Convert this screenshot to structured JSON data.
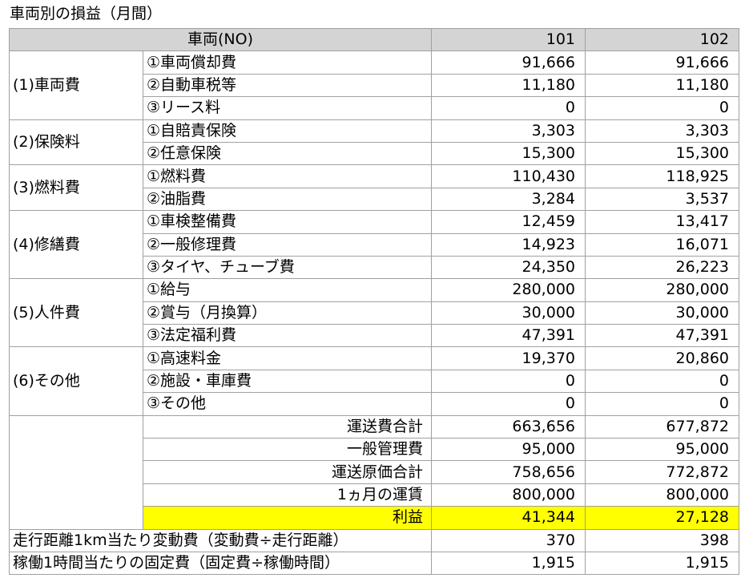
{
  "title": "車両別の損益（月間）",
  "header": {
    "label": "車両(NO)",
    "vehicles": [
      "101",
      "102"
    ]
  },
  "groups": [
    {
      "name": "(1)車両費",
      "items": [
        {
          "label": "①車両償却費",
          "values": [
            "91,666",
            "91,666"
          ]
        },
        {
          "label": "②自動車税等",
          "values": [
            "11,180",
            "11,180"
          ]
        },
        {
          "label": "③リース料",
          "values": [
            "0",
            "0"
          ]
        }
      ]
    },
    {
      "name": "(2)保険料",
      "items": [
        {
          "label": "①自賠責保険",
          "values": [
            "3,303",
            "3,303"
          ]
        },
        {
          "label": "②任意保険",
          "values": [
            "15,300",
            "15,300"
          ]
        }
      ]
    },
    {
      "name": "(3)燃料費",
      "items": [
        {
          "label": "①燃料費",
          "values": [
            "110,430",
            "118,925"
          ]
        },
        {
          "label": "②油脂費",
          "values": [
            "3,284",
            "3,537"
          ]
        }
      ]
    },
    {
      "name": "(4)修繕費",
      "items": [
        {
          "label": "①車検整備費",
          "values": [
            "12,459",
            "13,417"
          ]
        },
        {
          "label": "②一般修理費",
          "values": [
            "14,923",
            "16,071"
          ]
        },
        {
          "label": "③タイヤ、チューブ費",
          "values": [
            "24,350",
            "26,223"
          ]
        }
      ]
    },
    {
      "name": "(5)人件費",
      "items": [
        {
          "label": "①給与",
          "values": [
            "280,000",
            "280,000"
          ]
        },
        {
          "label": "②賞与（月換算）",
          "values": [
            "30,000",
            "30,000"
          ]
        },
        {
          "label": "③法定福利費",
          "values": [
            "47,391",
            "47,391"
          ]
        }
      ]
    },
    {
      "name": "(6)その他",
      "items": [
        {
          "label": "①高速料金",
          "values": [
            "19,370",
            "20,860"
          ]
        },
        {
          "label": "②施設・車庫費",
          "values": [
            "0",
            "0"
          ]
        },
        {
          "label": "③その他",
          "values": [
            "0",
            "0"
          ]
        }
      ]
    }
  ],
  "summary": [
    {
      "label": "運送費合計",
      "values": [
        "663,656",
        "677,872"
      ],
      "highlight": false
    },
    {
      "label": "一般管理費",
      "values": [
        "95,000",
        "95,000"
      ],
      "highlight": false
    },
    {
      "label": "運送原価合計",
      "values": [
        "758,656",
        "772,872"
      ],
      "highlight": false
    },
    {
      "label": "1ヵ月の運賃",
      "values": [
        "800,000",
        "800,000"
      ],
      "highlight": false
    },
    {
      "label": "利益",
      "values": [
        "41,344",
        "27,128"
      ],
      "highlight": true
    }
  ],
  "footer": [
    {
      "label": "走行距離1km当たり変動費（変動費÷走行距離）",
      "values": [
        "370",
        "398"
      ]
    },
    {
      "label": "稼働1時間当たりの固定費（固定費÷稼働時間）",
      "values": [
        "1,915",
        "1,915"
      ]
    }
  ],
  "colors": {
    "header_bg": "#d4d4d4",
    "highlight_bg": "#ffff00",
    "border": "#a0a0a0"
  }
}
